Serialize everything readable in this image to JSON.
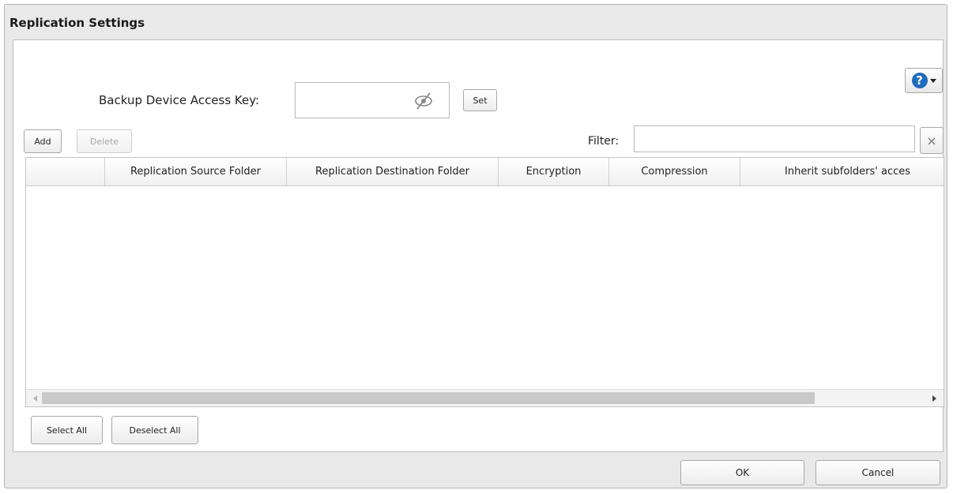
{
  "dialog": {
    "title": "Replication Settings"
  },
  "help": {
    "icon": "help-icon",
    "glyph": "?",
    "menu_icon": "chevron-down-icon"
  },
  "access_key": {
    "label": "Backup Device Access Key:",
    "value": "",
    "icon": "eye-off-icon",
    "set_label": "Set"
  },
  "toolbar": {
    "add_label": "Add",
    "delete_label": "Delete"
  },
  "filter": {
    "label": "Filter:",
    "value": "",
    "clear_icon": "close-icon",
    "clear_glyph": "×"
  },
  "table": {
    "columns": [
      "",
      "Replication Source Folder",
      "Replication Destination Folder",
      "Encryption",
      "Compression",
      "Inherit subfolders' acces"
    ],
    "rows": []
  },
  "selection": {
    "select_all_label": "Select All",
    "deselect_all_label": "Deselect All"
  },
  "footer": {
    "ok_label": "OK",
    "cancel_label": "Cancel"
  },
  "colors": {
    "accent": "#1f6bbf",
    "panel_bg": "#e9e9e9"
  }
}
